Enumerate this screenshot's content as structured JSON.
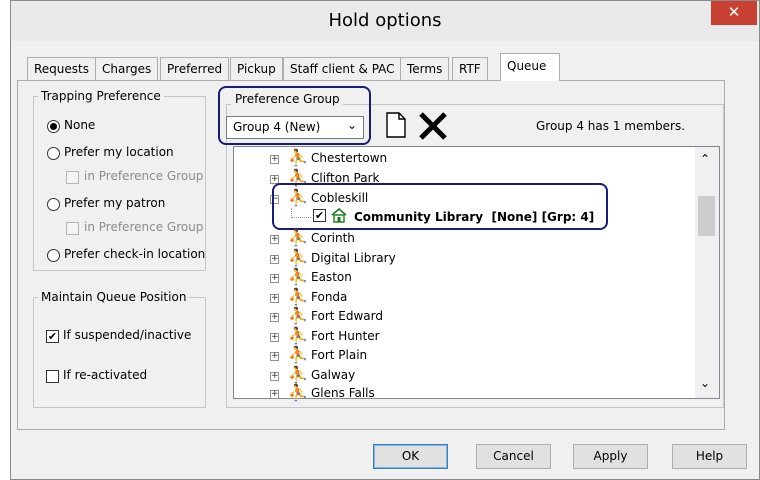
{
  "window": {
    "title": "Hold options",
    "close_label": "✕"
  },
  "tabs": [
    "Requests",
    "Charges",
    "Preferred",
    "Pickup",
    "Staff client & PAC",
    "Terms",
    "RTF",
    "Queue"
  ],
  "active_tab": "Queue",
  "trapping": {
    "title": "Trapping Preference",
    "none": "None",
    "prefer_location": "Prefer my location",
    "prefer_patron": "Prefer my patron",
    "in_group_1": "in Preference Group",
    "in_group_2": "in Preference Group",
    "prefer_checkin": "Prefer check-in location",
    "selected": "None"
  },
  "queue_position": {
    "title": "Maintain Queue Position",
    "if_suspended": "If suspended/inactive",
    "if_suspended_checked": true,
    "if_reactivated": "If re-activated",
    "if_reactivated_checked": false
  },
  "preference_group": {
    "title": "Preference Group",
    "selected": "Group 4 (New)",
    "members_text": "Group 4 has 1 members.",
    "new_icon": "new-document-icon",
    "delete_icon": "delete-x-icon"
  },
  "tree": {
    "items": [
      {
        "label": "Chestertown"
      },
      {
        "label": "Clifton Park"
      },
      {
        "label": "Cobleskill",
        "expanded": true
      },
      {
        "label": "Corinth"
      },
      {
        "label": "Digital Library"
      },
      {
        "label": "Easton"
      },
      {
        "label": "Fonda"
      },
      {
        "label": "Fort Edward"
      },
      {
        "label": "Fort Hunter"
      },
      {
        "label": "Fort Plain"
      },
      {
        "label": "Galway"
      },
      {
        "label": "Glens Falls"
      }
    ],
    "child": {
      "label": "Community Library  [None] [Grp: 4]",
      "checked": true,
      "icon": "library-building-icon"
    }
  },
  "buttons": {
    "ok": "OK",
    "cancel": "Cancel",
    "apply": "Apply",
    "help": "Help"
  },
  "colors": {
    "highlight_outline": "#1b1c7a",
    "person_icon": "#1f44c8",
    "close_button": "#c84031"
  }
}
